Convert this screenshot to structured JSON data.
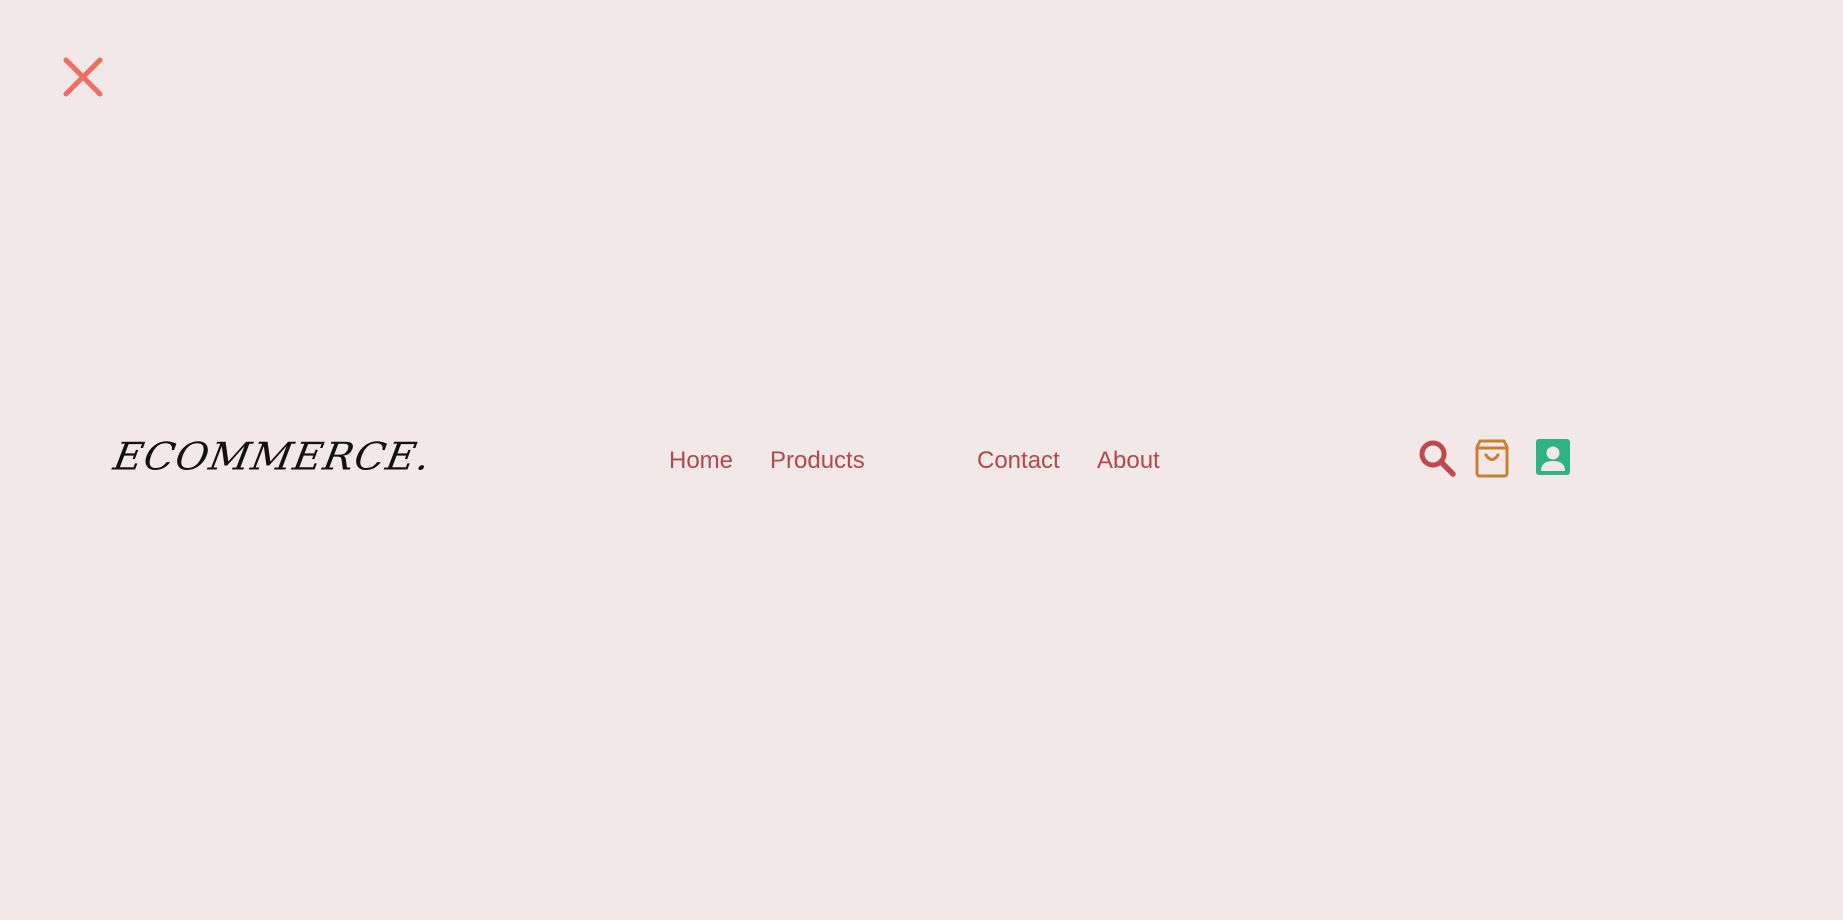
{
  "close_button": {
    "icon": "close-icon",
    "color": "#f26b64"
  },
  "navbar": {
    "logo_text": "ECOMMERCE.",
    "links": [
      {
        "label": "Home"
      },
      {
        "label": "Products"
      },
      {
        "label": "Contact"
      },
      {
        "label": "About"
      }
    ],
    "link_color": "#b5494a",
    "actions": [
      {
        "icon": "search-icon",
        "color": "#c0484f"
      },
      {
        "icon": "shopping-bag-icon",
        "color": "#c98033"
      },
      {
        "icon": "user-account-icon",
        "color": "#2fb383"
      }
    ]
  },
  "background_color": "#f2e8e7"
}
